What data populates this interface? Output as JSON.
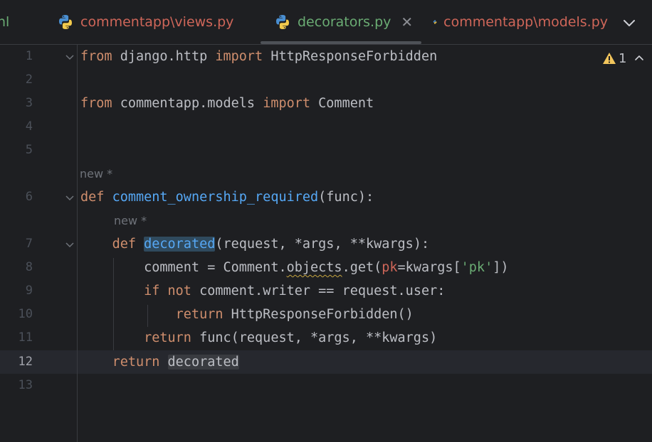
{
  "tabs": [
    {
      "label": "nl",
      "state": "partial"
    },
    {
      "label": "commentapp\\views.py",
      "state": "modified"
    },
    {
      "label": "decorators.py",
      "state": "active"
    },
    {
      "label": "commentapp\\models.py",
      "state": "modified"
    }
  ],
  "inspection": {
    "warning_count": "1"
  },
  "editor": {
    "current_line": "12",
    "inlay_new": "new *",
    "lines": [
      {
        "num": "1"
      },
      {
        "num": "2"
      },
      {
        "num": "3"
      },
      {
        "num": "4"
      },
      {
        "num": "5"
      },
      {
        "num": "6"
      },
      {
        "num": "7"
      },
      {
        "num": "8"
      },
      {
        "num": "9"
      },
      {
        "num": "10"
      },
      {
        "num": "11"
      },
      {
        "num": "12"
      },
      {
        "num": "13"
      }
    ],
    "tokens": {
      "from": "from",
      "import": "import",
      "django_http": " django.http ",
      "forbidden": " HttpResponseForbidden",
      "commentapp_models": " commentapp.models ",
      "comment": " Comment",
      "def": "def",
      "comment_ownership_required": "comment_ownership_required",
      "func_sig": "(func):",
      "decorated": "decorated",
      "decorated_sig": "(request, *args, **kwargs):",
      "comment_assign": "comment = Comment.",
      "objects": "objects",
      "get_open": ".get(",
      "pk": "pk",
      "kwargs_idx": "=kwargs[",
      "pk_str": "'pk'",
      "close_br": "])",
      "if": "if",
      "not": "not",
      "cond": " comment.writer == request.user:",
      "return": "return",
      "forbidden_call": " HttpResponseForbidden()",
      "func_call": " func(request, *args, **kwargs)"
    }
  },
  "colors": {
    "background": "#1e1f22",
    "keyword": "#cf8e6d",
    "function": "#56a8f5",
    "string": "#6aab73",
    "param": "#cf6659",
    "modified_tab": "#cf6659",
    "active_tab": "#6aab73"
  },
  "icons": {
    "file": "python-icon",
    "close": "close-icon",
    "dropdown": "chevron-down-icon",
    "warning": "warning-triangle-icon",
    "fold": "fold-chevron-icon"
  }
}
